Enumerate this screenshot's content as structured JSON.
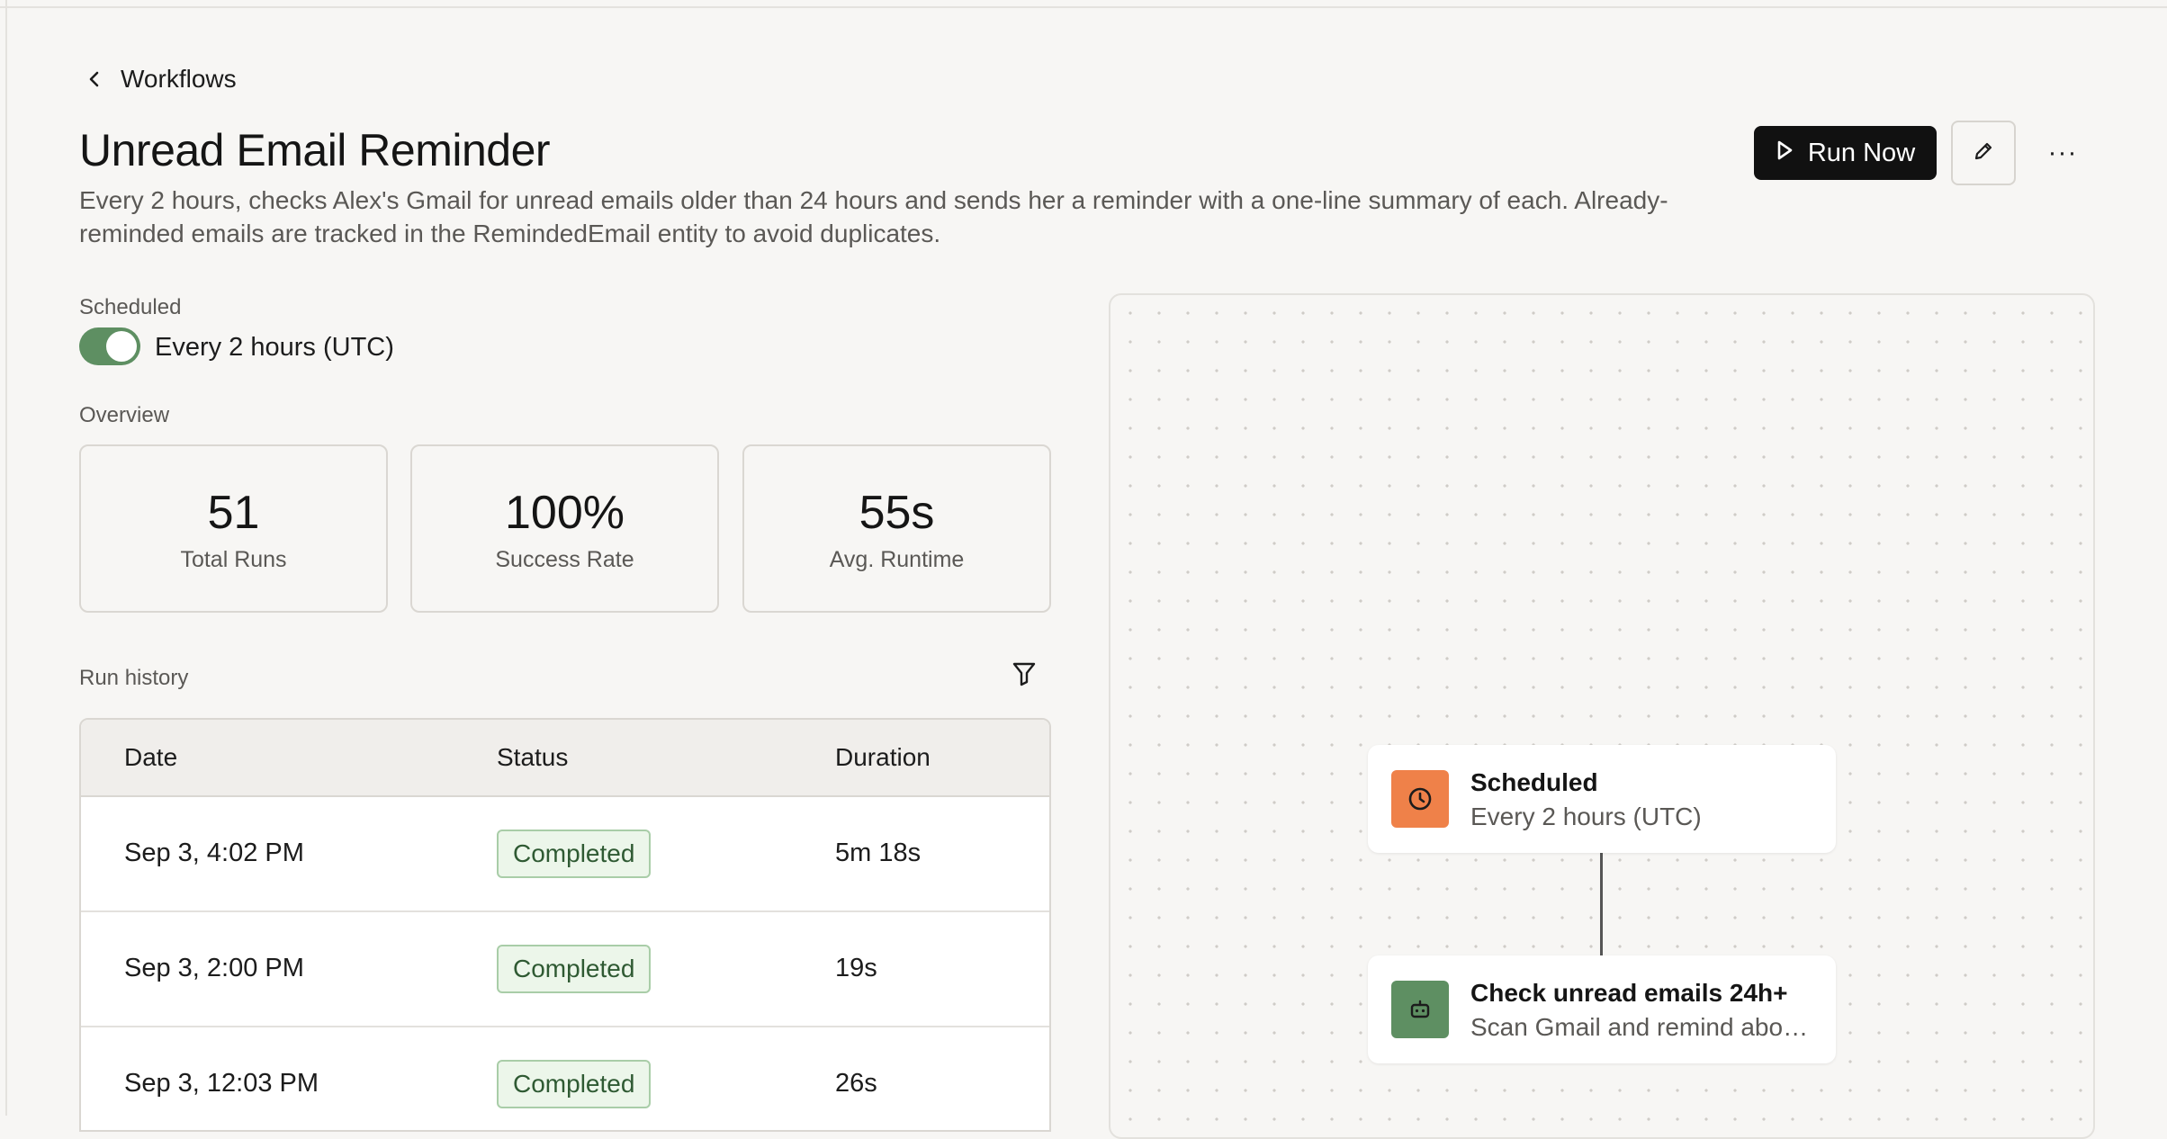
{
  "breadcrumb": {
    "back_label": "Workflows"
  },
  "header": {
    "title": "Unread Email Reminder",
    "description": "Every 2 hours, checks Alex's Gmail for unread emails older than 24 hours and sends her a reminder with a one-line summary of each. Already-reminded emails are tracked in the RemindedEmail entity to avoid duplicates.",
    "run_now_label": "Run Now",
    "more_label": "···"
  },
  "schedule": {
    "label": "Scheduled",
    "enabled": true,
    "value": "Every 2 hours (UTC)"
  },
  "overview": {
    "label": "Overview",
    "stats": [
      {
        "value": "51",
        "label": "Total Runs"
      },
      {
        "value": "100%",
        "label": "Success Rate"
      },
      {
        "value": "55s",
        "label": "Avg. Runtime"
      }
    ]
  },
  "run_history": {
    "label": "Run history",
    "columns": [
      "Date",
      "Status",
      "Duration"
    ],
    "rows": [
      {
        "date": "Sep 3, 4:02 PM",
        "status": "Completed",
        "duration": "5m 18s"
      },
      {
        "date": "Sep 3, 2:00 PM",
        "status": "Completed",
        "duration": "19s"
      },
      {
        "date": "Sep 3, 12:03 PM",
        "status": "Completed",
        "duration": "26s"
      }
    ]
  },
  "flow": {
    "nodes": [
      {
        "title": "Scheduled",
        "subtitle": "Every 2 hours (UTC)",
        "icon": "clock-icon",
        "color": "#ef8149"
      },
      {
        "title": "Check unread emails 24h+",
        "subtitle": "Scan Gmail and remind about unread emails",
        "icon": "robot-icon",
        "color": "#5e8f62"
      }
    ]
  },
  "colors": {
    "accent": "#5e8f62",
    "primary_button": "#111111",
    "badge_text": "#2f5a33",
    "badge_bg": "#ecf6ea"
  }
}
